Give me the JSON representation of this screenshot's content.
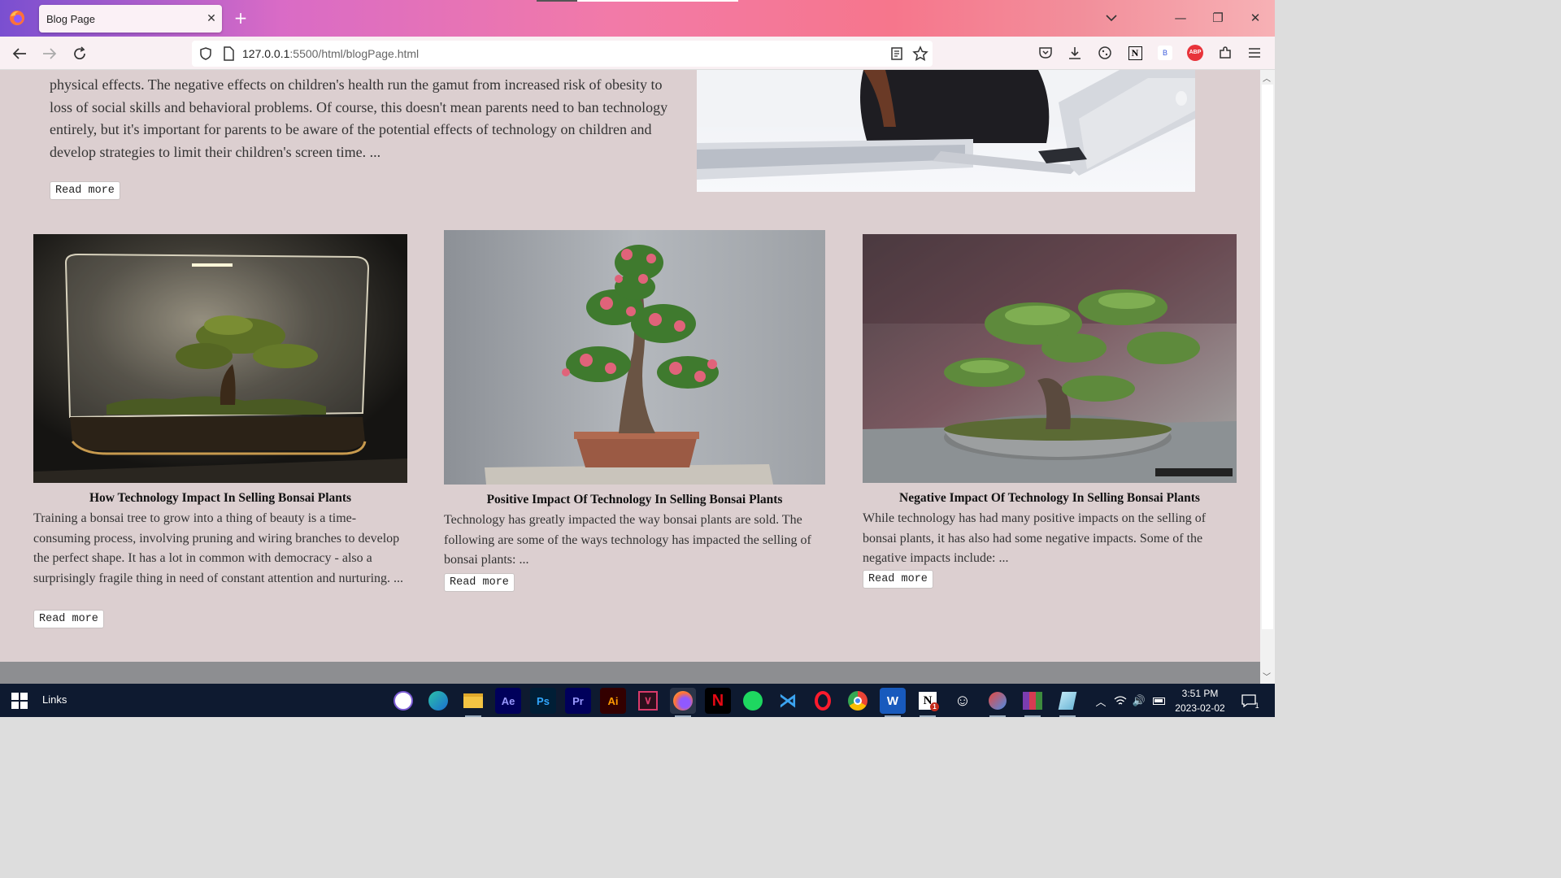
{
  "browser": {
    "tab_title": "Blog Page",
    "url_host": "127.0.0.1",
    "url_path": ":5500/html/blogPage.html"
  },
  "hero": {
    "text": "physical effects. The negative effects on children's health run the gamut from increased risk of obesity to loss of social skills and behavioral problems. Of course, this doesn't mean parents need to ban technology entirely, but it's important for parents to be aware of the potential effects of technology on children and develop strategies to limit their children's screen time. ...",
    "read_more": "Read more"
  },
  "cards": [
    {
      "title": "How Technology Impact In Selling Bonsai Plants",
      "text": "Training a bonsai tree to grow into a thing of beauty is a time-consuming process, involving pruning and wiring branches to develop the perfect shape. It has a lot in common with democracy - also a surprisingly fragile thing in need of constant attention and nurturing. ...",
      "read_more": "Read more"
    },
    {
      "title": "Positive Impact Of Technology In Selling Bonsai Plants",
      "text": "Technology has greatly impacted the way bonsai plants are sold. The following are some of the ways technology has impacted the selling of bonsai plants: ...",
      "read_more": "Read more"
    },
    {
      "title": "Negative Impact Of Technology In Selling Bonsai Plants",
      "text": "While technology has had many positive impacts on the selling of bonsai plants, it has also had some negative impacts. Some of the negative impacts include: ...",
      "read_more": "Read more"
    }
  ],
  "taskbar": {
    "links_label": "Links",
    "apps": [
      "viber",
      "edge",
      "file-explorer",
      "Ae",
      "Ps",
      "Pr",
      "Ai",
      "vectr",
      "firefox",
      "netflix",
      "spotify",
      "vscode",
      "opera",
      "chrome",
      "word",
      "notion",
      "emoji",
      "app",
      "winrar",
      "app2"
    ],
    "time": "3:51 PM",
    "date": "2023-02-02",
    "notification_count": "1"
  },
  "colors": {
    "page_bg": "#dccfd0",
    "taskbar_bg": "#0e1a30",
    "footer_band": "#8d8e91"
  }
}
